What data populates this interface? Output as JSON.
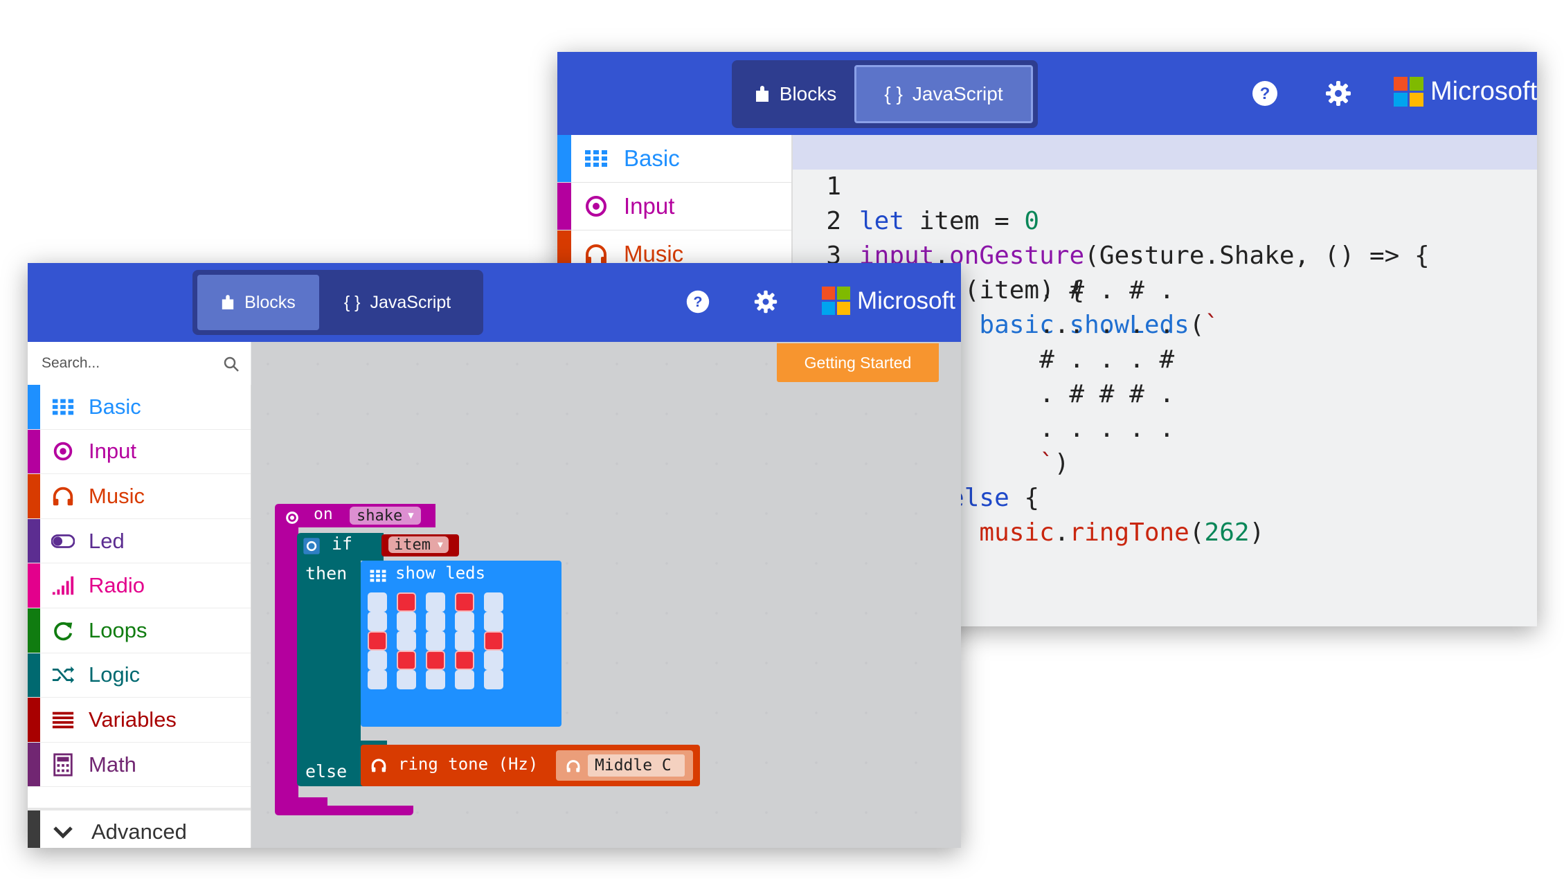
{
  "back_window": {
    "tabs": [
      {
        "label": "Blocks",
        "active": false
      },
      {
        "label": "JavaScript",
        "active": true
      }
    ],
    "brand": "Microsoft",
    "sidebar": [
      {
        "label": "Basic",
        "color": "#1e90ff"
      },
      {
        "label": "Input",
        "color": "#b4009e"
      },
      {
        "label": "Music",
        "color": "#d83b01"
      }
    ],
    "code_lines": [
      {
        "n": "1",
        "text": "let item = 0"
      },
      {
        "n": "2",
        "text": "input.onGesture(Gesture.Shake, () => {"
      },
      {
        "n": "3",
        "text": "    if (item) {"
      },
      {
        "n": "4",
        "text": "        basic.showLeds(`"
      },
      {
        "n": "",
        "text": "            . # . # ."
      },
      {
        "n": "",
        "text": "            . . . . ."
      },
      {
        "n": "",
        "text": "            # . . . #"
      },
      {
        "n": "",
        "text": "            . # # # ."
      },
      {
        "n": "",
        "text": "            . . . . ."
      },
      {
        "n": "",
        "text": "            `)"
      },
      {
        "n": "",
        "text": "    } else {"
      },
      {
        "n": "",
        "text": "        music.ringTone(262)"
      }
    ]
  },
  "front_window": {
    "tabs": [
      {
        "label": "Blocks",
        "active": true
      },
      {
        "label": "JavaScript",
        "active": false
      }
    ],
    "brand": "Microsoft",
    "search_placeholder": "Search...",
    "categories": [
      {
        "label": "Basic",
        "color": "#1e90ff",
        "icon": "grid-icon"
      },
      {
        "label": "Input",
        "color": "#b4009e",
        "icon": "target-icon"
      },
      {
        "label": "Music",
        "color": "#d83b01",
        "icon": "headphones-icon"
      },
      {
        "label": "Led",
        "color": "#5c2d91",
        "icon": "toggle-icon"
      },
      {
        "label": "Radio",
        "color": "#e3008c",
        "icon": "signal-icon"
      },
      {
        "label": "Loops",
        "color": "#107c10",
        "icon": "loop-icon"
      },
      {
        "label": "Logic",
        "color": "#006970",
        "icon": "shuffle-icon"
      },
      {
        "label": "Variables",
        "color": "#a80000",
        "icon": "list-icon"
      },
      {
        "label": "Math",
        "color": "#712672",
        "icon": "calculator-icon"
      }
    ],
    "advanced_label": "Advanced",
    "getting_started": "Getting Started",
    "blocks": {
      "on_label": "on",
      "event": "shake",
      "if_label": "if",
      "variable": "item",
      "then_label": "then",
      "show_leds": "show leds",
      "else_label": "else",
      "ring_tone": "ring tone (Hz)",
      "note": "Middle C",
      "leds": [
        [
          0,
          1,
          0,
          1,
          0
        ],
        [
          0,
          0,
          0,
          0,
          0
        ],
        [
          1,
          0,
          0,
          0,
          1
        ],
        [
          0,
          1,
          1,
          1,
          0
        ],
        [
          0,
          0,
          0,
          0,
          0
        ]
      ]
    }
  }
}
